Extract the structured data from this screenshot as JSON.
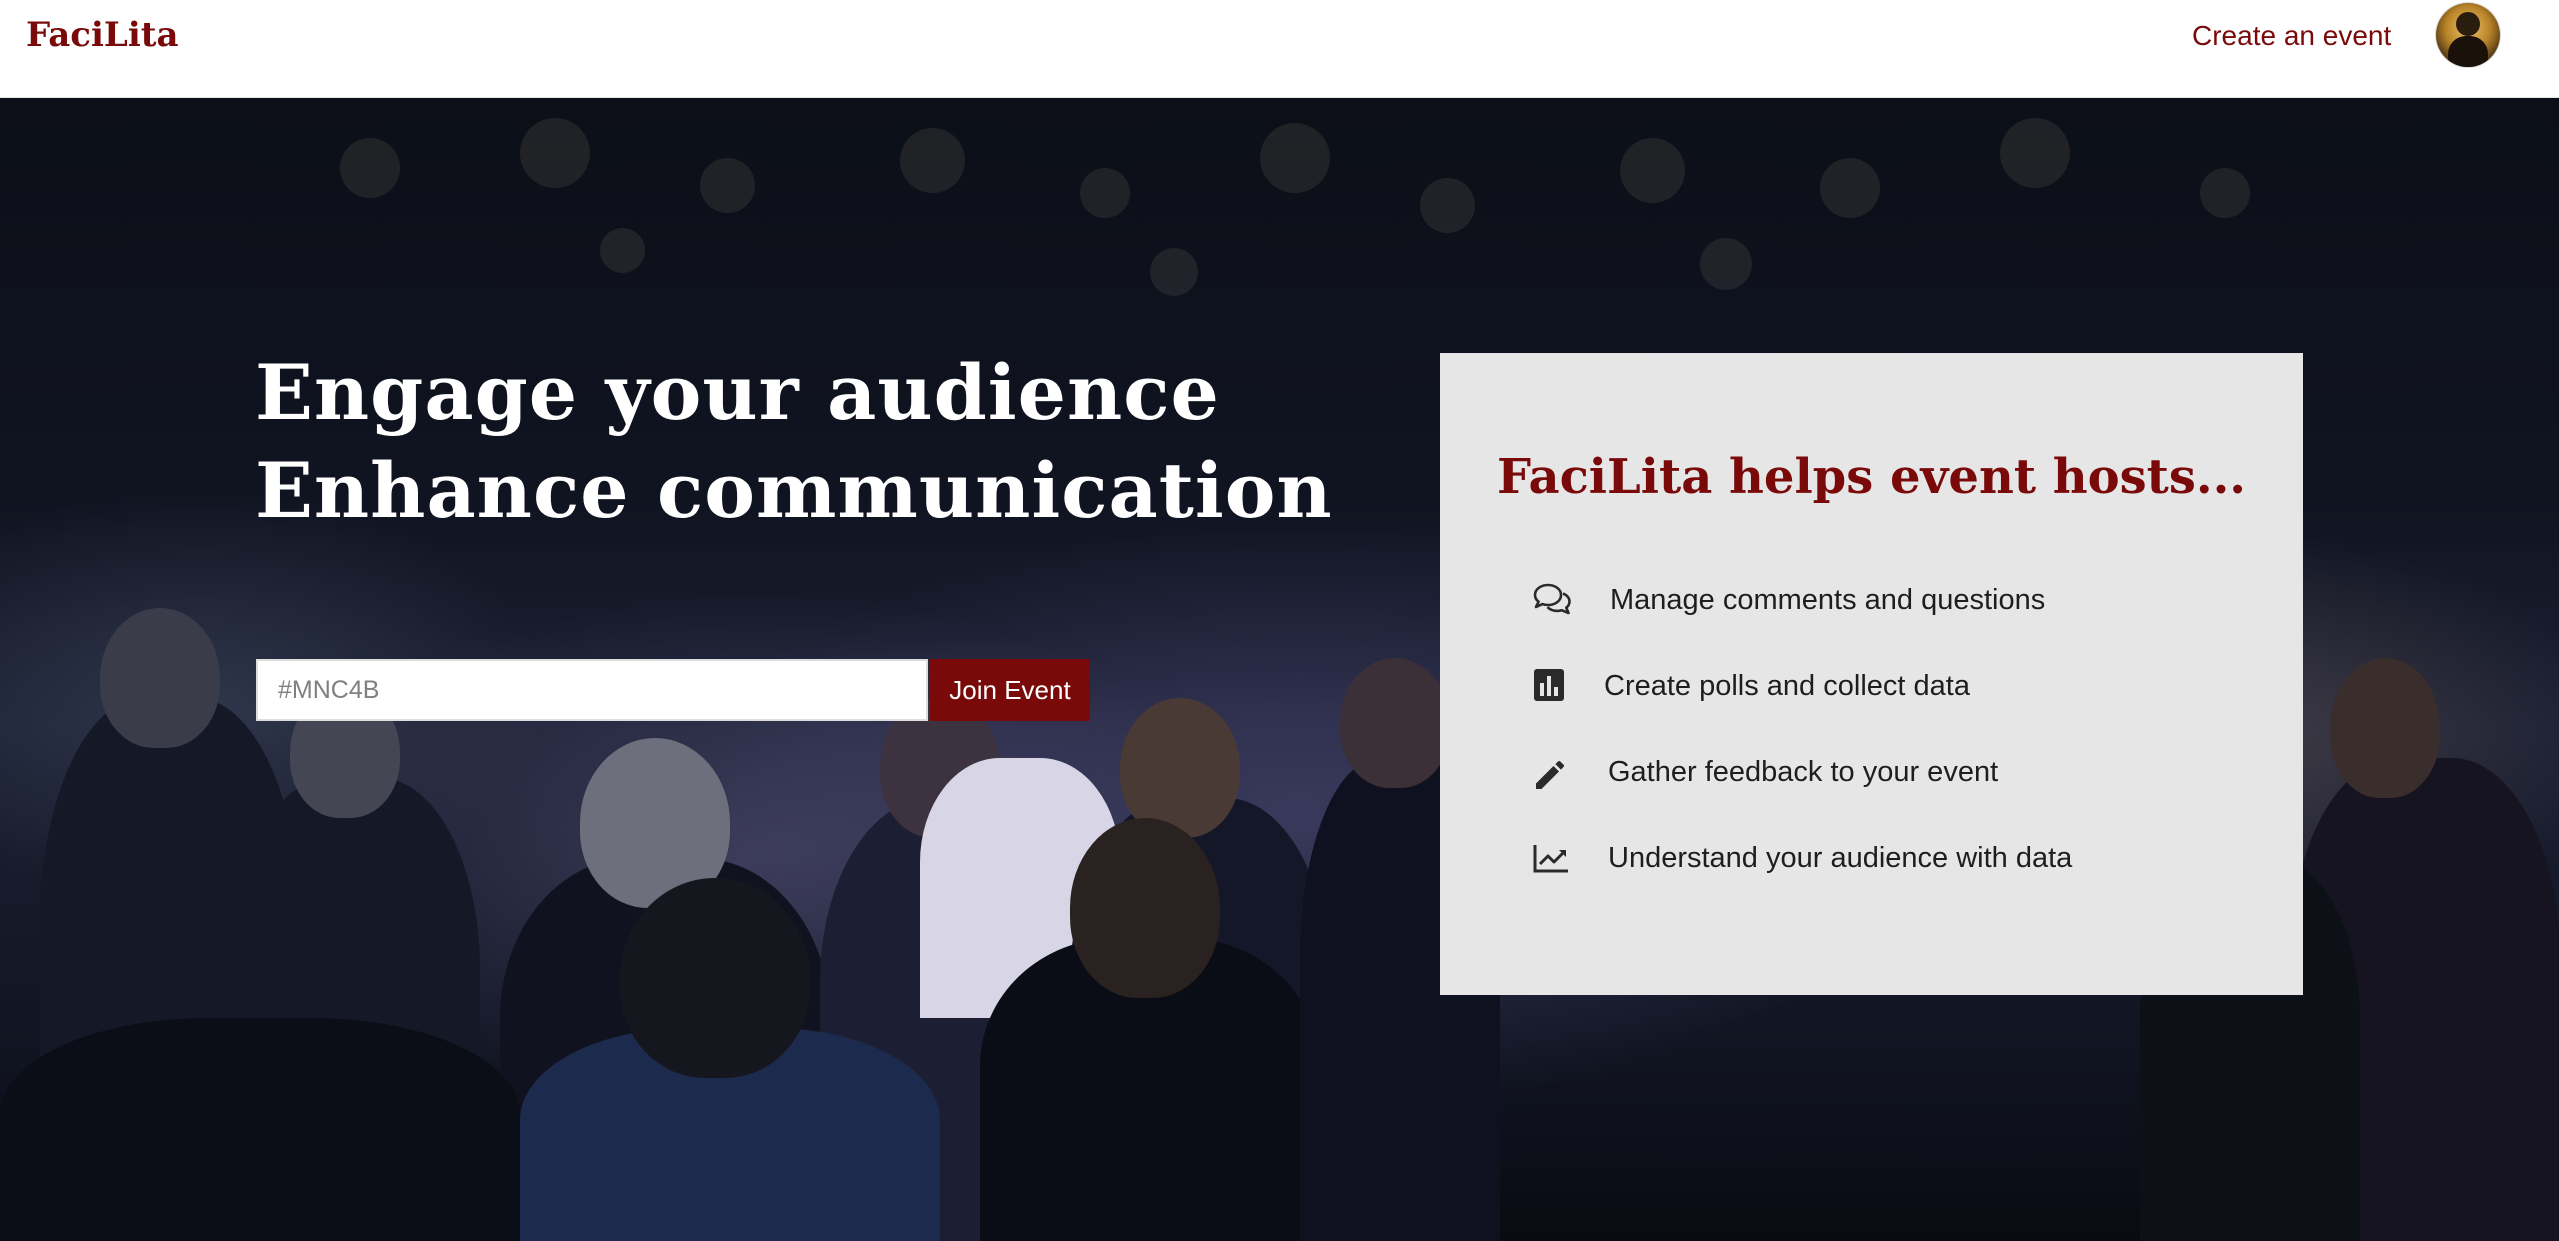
{
  "navbar": {
    "brand": "FaciLita",
    "create_event_label": "Create an event",
    "avatar_icon": "user-avatar"
  },
  "hero": {
    "title_line_1": "Engage your audience",
    "title_line_2": "Enhance communication",
    "join": {
      "placeholder": "#MNC4B",
      "value": "",
      "button_label": "Join Event"
    }
  },
  "features": {
    "title": "FaciLita helps event hosts...",
    "items": [
      {
        "icon": "comments-icon",
        "label": "Manage comments and questions"
      },
      {
        "icon": "poll-chart-icon",
        "label": "Create polls and collect data"
      },
      {
        "icon": "pencil-icon",
        "label": "Gather feedback to your event"
      },
      {
        "icon": "line-chart-icon",
        "label": "Understand your audience with data"
      }
    ]
  },
  "colors": {
    "brand": "#7a0a0a",
    "card_bg": "#e6e6e6",
    "navbar_bg": "#ffffff"
  }
}
